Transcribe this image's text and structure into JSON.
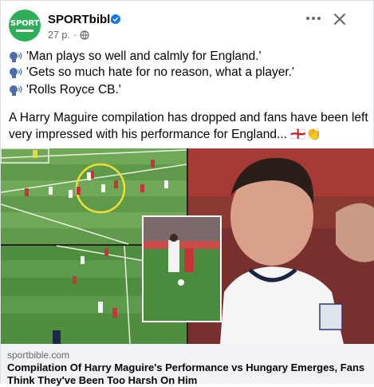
{
  "post": {
    "page_name": "SPORTbible",
    "avatar_text": "SPORT",
    "timestamp": "27 p.",
    "separator": "·",
    "quotes": [
      "'Man plays so well and calmly for England.'",
      "'Gets so much hate for no reason, what a player.'",
      "'Rolls Royce CB.'"
    ],
    "caption": "A Harry Maguire compilation has dropped and fans have been left very impressed with his performance for England... 🏴󠁧󠁢󠁥󠁮󠁧󠁿👏"
  },
  "link": {
    "domain": "sportbible.com",
    "headline": "Compilation Of Harry Maguire's Performance vs Hungary Emerges, Fans Think They've Been Too Harsh On Him"
  },
  "icons": {
    "verified": "verified-badge-icon",
    "globe": "globe-icon",
    "more": "more-options-icon",
    "close": "close-icon",
    "speech": "speaking-head-icon"
  },
  "colors": {
    "brand_green": "#2fae5a",
    "verified_blue": "#1877f2",
    "secondary_text": "#65676b",
    "link_card_bg": "#f0f2f5"
  }
}
